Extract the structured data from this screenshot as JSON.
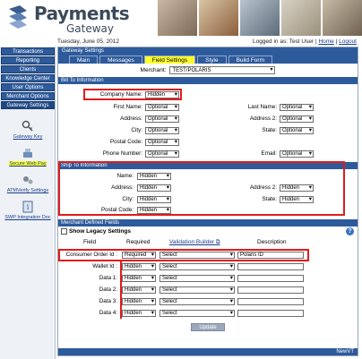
{
  "header": {
    "title": "Payments",
    "subtitle": "Gateway",
    "date": "Tuesday, June 05, 2012",
    "logged_in_prefix": "Logged in as: Test User",
    "home_link": "Home",
    "logout_link": "Logout",
    "separator": " | "
  },
  "sidebar": {
    "buttons": [
      "Transactions",
      "Reporting",
      "Clients",
      "Knowledge Center",
      "User Options",
      "Merchant Options",
      "Gateway Settings"
    ],
    "tools": [
      "Gateway Key",
      "Secure Web Pay",
      "ATMVerify Settings",
      "SWP Integration Doc"
    ]
  },
  "main": {
    "title": "Gateway Settings",
    "tabs": [
      "Main",
      "Messages",
      "Field Settings",
      "Style",
      "Build Form"
    ],
    "active_tab": "Field Settings",
    "merchant_label": "Merchant:",
    "merchant_value": "TEST/POLARIS"
  },
  "bill_to": {
    "title": "Bill To Information",
    "company_label": "Company Name:",
    "company_value": "Hidden",
    "fields_left": [
      {
        "label": "First Name:",
        "value": "Optional"
      },
      {
        "label": "Address:",
        "value": "Optional"
      },
      {
        "label": "City:",
        "value": "Optional"
      },
      {
        "label": "Postal Code:",
        "value": "Optional"
      },
      {
        "label": "Phone Number:",
        "value": "Optional"
      }
    ],
    "fields_right": [
      {
        "label": "Last Name:",
        "value": "Optional"
      },
      {
        "label": "Address 2:",
        "value": "Optional"
      },
      {
        "label": "State:",
        "value": "Optional"
      },
      {
        "label": "Email:",
        "value": "Optional"
      }
    ]
  },
  "ship_to": {
    "title": "Ship To Information",
    "fields_left": [
      {
        "label": "Name:",
        "value": "Hidden"
      },
      {
        "label": "Address:",
        "value": "Hidden"
      },
      {
        "label": "City:",
        "value": "Hidden"
      },
      {
        "label": "Postal Code:",
        "value": "Hidden"
      }
    ],
    "fields_right": [
      {
        "label": "Address 2:",
        "value": "Hidden"
      },
      {
        "label": "State:",
        "value": "Hidden"
      }
    ]
  },
  "merchant_defined": {
    "title": "Merchant Defined Fields",
    "legacy_label": "Show Legacy Settings",
    "col_field": "Field",
    "col_required": "Required",
    "col_validation": "Validation Builder",
    "col_description": "Description",
    "rows": [
      {
        "field": "Consumer Order Id :",
        "required": "Required",
        "validation": "Select",
        "description": "Polaris ID"
      },
      {
        "field": "Wallet Id :",
        "required": "Hidden",
        "validation": "Select",
        "description": ""
      },
      {
        "field": "Data 1:",
        "required": "Hidden",
        "validation": "Select",
        "description": ""
      },
      {
        "field": "Data 2:",
        "required": "Hidden",
        "validation": "Select",
        "description": ""
      },
      {
        "field": "Data 3:",
        "required": "Hidden",
        "validation": "Select",
        "description": ""
      },
      {
        "field": "Data 4:",
        "required": "Hidden",
        "validation": "Select",
        "description": ""
      }
    ],
    "update_label": "Update"
  },
  "footer": {
    "text": "NewVT"
  },
  "colors": {
    "nav_blue": "#2d5a9b",
    "highlight": "#ffff2a",
    "annotation_red": "#e21b1b"
  }
}
